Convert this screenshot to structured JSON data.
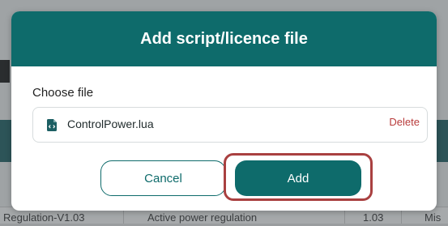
{
  "modal": {
    "title": "Add script/licence file",
    "choose_label": "Choose file",
    "file": {
      "name": "ControlPower.lua",
      "icon": "file-code-icon",
      "delete_label": "Delete"
    },
    "cancel_label": "Cancel",
    "add_label": "Add"
  },
  "background_table": {
    "row": {
      "col1": "Regulation-V1.03",
      "col2": "Active power regulation",
      "col3": "1.03",
      "col4": "Mis"
    }
  },
  "colors": {
    "header": "#0e6b6b",
    "primary": "#0e6b6b",
    "danger": "#b83b3b",
    "highlight": "#a94040"
  }
}
